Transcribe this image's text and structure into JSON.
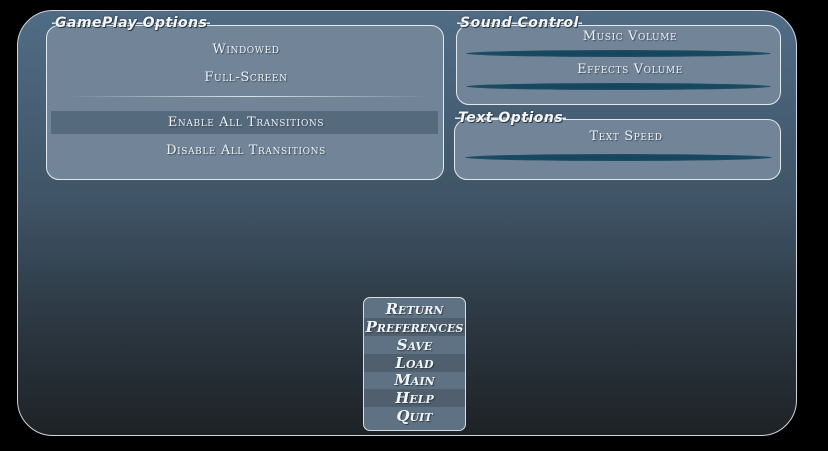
{
  "gameplay": {
    "title": "GamePlay Options",
    "windowed": "Windowed",
    "fullscreen": "Full-Screen",
    "enable_transitions": "Enable All Transitions",
    "disable_transitions": "Disable All Transitions"
  },
  "sound": {
    "title": "Sound Control",
    "music_volume": "Music Volume",
    "effects_volume": "Effects Volume"
  },
  "text_options": {
    "title": "Text Options",
    "text_speed": "Text Speed"
  },
  "menu": {
    "return": "Return",
    "preferences": "Preferences",
    "save": "Save",
    "load": "Load",
    "main": "Main",
    "help": "Help",
    "quit": "Quit"
  },
  "colors": {
    "panel_fill": "#728598",
    "panel_border": "#e3e8ec",
    "slider_track": "#14435a",
    "selected_row": "#556a7d",
    "menu_fill": "#5f7284"
  }
}
